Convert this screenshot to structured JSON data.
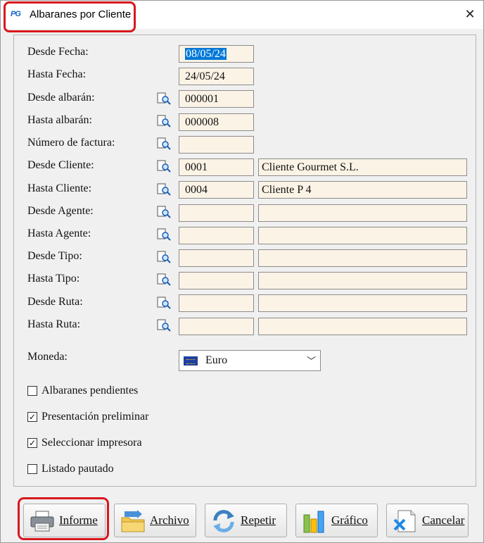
{
  "window": {
    "title": "Albaranes por Cliente",
    "logo_text": "PG",
    "close_glyph": "✕"
  },
  "fields": {
    "desde_fecha": {
      "label": "Desde Fecha:",
      "value": "08/05/24"
    },
    "hasta_fecha": {
      "label": "Hasta Fecha:",
      "value": "24/05/24"
    },
    "desde_albaran": {
      "label": "Desde albarán:",
      "value": "000001"
    },
    "hasta_albaran": {
      "label": "Hasta albarán:",
      "value": "000008"
    },
    "numero_factura": {
      "label": "Número de factura:",
      "value": ""
    },
    "desde_cliente": {
      "label": "Desde Cliente:",
      "value": "0001",
      "name": "Cliente Gourmet S.L."
    },
    "hasta_cliente": {
      "label": "Hasta Cliente:",
      "value": "0004",
      "name": "Cliente P 4"
    },
    "desde_agente": {
      "label": "Desde Agente:",
      "value": "",
      "name": ""
    },
    "hasta_agente": {
      "label": "Hasta Agente:",
      "value": "",
      "name": ""
    },
    "desde_tipo": {
      "label": "Desde Tipo:",
      "value": "",
      "name": ""
    },
    "hasta_tipo": {
      "label": "Hasta Tipo:",
      "value": "",
      "name": ""
    },
    "desde_ruta": {
      "label": "Desde Ruta:",
      "value": "",
      "name": ""
    },
    "hasta_ruta": {
      "label": "Hasta Ruta:",
      "value": "",
      "name": ""
    }
  },
  "moneda": {
    "label": "Moneda:",
    "value": "Euro"
  },
  "options": {
    "albaranes_pendientes": {
      "label": "Albaranes pendientes",
      "checked": false
    },
    "presentacion_preliminar": {
      "label": "Presentación preliminar",
      "checked": true
    },
    "seleccionar_impresora": {
      "label": "Seleccionar impresora",
      "checked": true
    },
    "listado_pautado": {
      "label": "Listado pautado",
      "checked": false
    }
  },
  "buttons": {
    "informe": "Informe",
    "archivo": "Archivo",
    "repetir": "Repetir",
    "grafico": "Gráfico",
    "cancelar": "Cancelar"
  },
  "colors": {
    "highlight": "#d8181e",
    "field_bg": "#fbf3e5",
    "selection": "#0078d7"
  }
}
